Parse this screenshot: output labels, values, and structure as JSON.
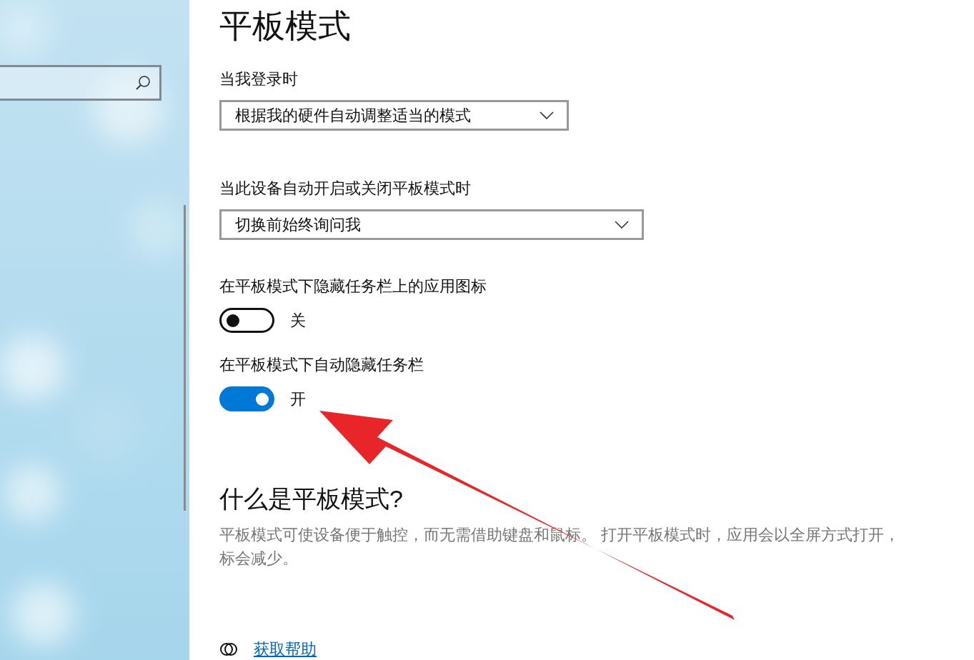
{
  "page": {
    "title": "平板模式",
    "settings": [
      {
        "kind": "dropdown",
        "label": "当我登录时",
        "value": "根据我的硬件自动调整适当的模式"
      },
      {
        "kind": "dropdown",
        "label": "当此设备自动开启或关闭平板模式时",
        "value": "切换前始终询问我"
      },
      {
        "kind": "toggle",
        "label": "在平板模式下隐藏任务栏上的应用图标",
        "on": false,
        "state_text": "关"
      },
      {
        "kind": "toggle",
        "label": "在平板模式下自动隐藏任务栏",
        "on": true,
        "state_text": "开"
      }
    ],
    "about": {
      "heading": "什么是平板模式?",
      "lines": [
        "平板模式可使设备便于触控，而无需借助键盘和鼠标。 打开平板模式时，应用会以全屏方式打开，",
        "标会减少。"
      ]
    },
    "help_link": "获取帮助"
  }
}
